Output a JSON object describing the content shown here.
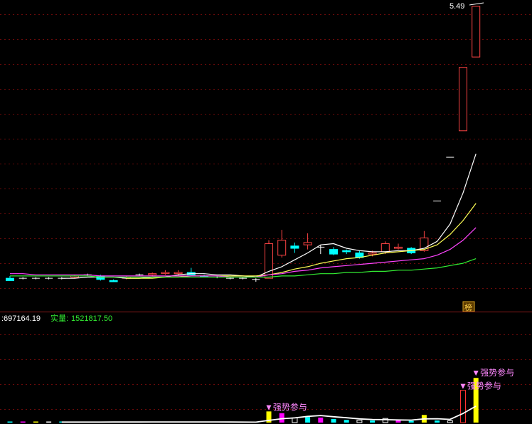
{
  "chart_data": {
    "type": "candlestick",
    "price_panel": {
      "max_label": "5.49",
      "marker_label": "榜",
      "ylim": [
        3.1,
        5.52
      ],
      "grid": true,
      "candles": [
        {
          "o": 3.13,
          "h": 3.15,
          "l": 3.11,
          "c": 3.11
        },
        {
          "o": 3.13,
          "h": 3.14,
          "l": 3.12,
          "c": 3.13
        },
        {
          "o": 3.13,
          "h": 3.14,
          "l": 3.12,
          "c": 3.13
        },
        {
          "o": 3.13,
          "h": 3.14,
          "l": 3.12,
          "c": 3.13
        },
        {
          "o": 3.13,
          "h": 3.14,
          "l": 3.12,
          "c": 3.13
        },
        {
          "o": 3.14,
          "h": 3.16,
          "l": 3.13,
          "c": 3.15
        },
        {
          "o": 3.16,
          "h": 3.17,
          "l": 3.15,
          "c": 3.16
        },
        {
          "o": 3.15,
          "h": 3.16,
          "l": 3.11,
          "c": 3.12
        },
        {
          "o": 3.11,
          "h": 3.12,
          "l": 3.1,
          "c": 3.1
        },
        {
          "o": 3.13,
          "h": 3.15,
          "l": 3.12,
          "c": 3.14
        },
        {
          "o": 3.16,
          "h": 3.17,
          "l": 3.15,
          "c": 3.16
        },
        {
          "o": 3.16,
          "h": 3.18,
          "l": 3.15,
          "c": 3.17
        },
        {
          "o": 3.17,
          "h": 3.2,
          "l": 3.16,
          "c": 3.18
        },
        {
          "o": 3.17,
          "h": 3.2,
          "l": 3.15,
          "c": 3.18
        },
        {
          "o": 3.18,
          "h": 3.22,
          "l": 3.16,
          "c": 3.16
        },
        {
          "o": 3.15,
          "h": 3.16,
          "l": 3.14,
          "c": 3.14
        },
        {
          "o": 3.14,
          "h": 3.15,
          "l": 3.13,
          "c": 3.14
        },
        {
          "o": 3.13,
          "h": 3.14,
          "l": 3.12,
          "c": 3.13
        },
        {
          "o": 3.13,
          "h": 3.14,
          "l": 3.12,
          "c": 3.13
        },
        {
          "o": 3.12,
          "h": 3.13,
          "l": 3.1,
          "c": 3.12
        },
        {
          "o": 3.13,
          "h": 3.46,
          "l": 3.13,
          "c": 3.43
        },
        {
          "o": 3.33,
          "h": 3.55,
          "l": 3.31,
          "c": 3.46
        },
        {
          "o": 3.41,
          "h": 3.44,
          "l": 3.35,
          "c": 3.39
        },
        {
          "o": 3.42,
          "h": 3.52,
          "l": 3.38,
          "c": 3.44
        },
        {
          "o": 3.4,
          "h": 3.42,
          "l": 3.34,
          "c": 3.4
        },
        {
          "o": 3.38,
          "h": 3.4,
          "l": 3.33,
          "c": 3.34
        },
        {
          "o": 3.37,
          "h": 3.38,
          "l": 3.34,
          "c": 3.36
        },
        {
          "o": 3.35,
          "h": 3.37,
          "l": 3.3,
          "c": 3.31
        },
        {
          "o": 3.34,
          "h": 3.37,
          "l": 3.32,
          "c": 3.35
        },
        {
          "o": 3.36,
          "h": 3.45,
          "l": 3.34,
          "c": 3.43
        },
        {
          "o": 3.39,
          "h": 3.43,
          "l": 3.38,
          "c": 3.4
        },
        {
          "o": 3.39,
          "h": 3.4,
          "l": 3.34,
          "c": 3.35
        },
        {
          "o": 3.37,
          "h": 3.54,
          "l": 3.36,
          "c": 3.48
        },
        {
          "o": 3.8,
          "h": 3.8,
          "l": 3.8,
          "c": 3.8
        },
        {
          "o": 4.18,
          "h": 4.18,
          "l": 4.18,
          "c": 4.18
        },
        {
          "o": 4.41,
          "h": 4.96,
          "l": 4.41,
          "c": 4.96
        },
        {
          "o": 5.05,
          "h": 5.49,
          "l": 5.05,
          "c": 5.49
        }
      ],
      "ma_lines": [
        {
          "name": "ma-white",
          "color": "#ffffff",
          "values": [
            null,
            null,
            null,
            null,
            3.13,
            3.13,
            3.14,
            3.14,
            3.14,
            3.13,
            3.13,
            3.14,
            3.14,
            3.16,
            3.17,
            3.17,
            3.16,
            3.16,
            3.15,
            3.14,
            3.19,
            3.23,
            3.29,
            3.35,
            3.42,
            3.43,
            3.39,
            3.37,
            3.36,
            3.36,
            3.37,
            3.37,
            3.39,
            3.45,
            3.6,
            3.87,
            4.21
          ]
        },
        {
          "name": "ma-yellow",
          "color": "#ffff55",
          "values": [
            null,
            null,
            null,
            null,
            null,
            null,
            null,
            null,
            null,
            3.13,
            3.13,
            3.13,
            3.14,
            3.14,
            3.15,
            3.15,
            3.15,
            3.15,
            3.15,
            3.15,
            3.16,
            3.18,
            3.21,
            3.23,
            3.26,
            3.28,
            3.3,
            3.31,
            3.33,
            3.35,
            3.36,
            3.37,
            3.38,
            3.42,
            3.51,
            3.63,
            3.78
          ]
        },
        {
          "name": "ma-magenta",
          "color": "#ff44ff",
          "values": [
            3.17,
            3.17,
            3.16,
            3.16,
            3.16,
            3.16,
            3.16,
            3.15,
            3.15,
            3.15,
            3.15,
            3.15,
            3.15,
            3.15,
            3.15,
            3.15,
            3.15,
            3.14,
            3.14,
            3.14,
            3.16,
            3.17,
            3.19,
            3.2,
            3.22,
            3.23,
            3.24,
            3.25,
            3.26,
            3.27,
            3.28,
            3.29,
            3.3,
            3.33,
            3.38,
            3.46,
            3.57
          ]
        },
        {
          "name": "ma-green",
          "color": "#33ee33",
          "values": [
            3.15,
            3.15,
            3.15,
            3.15,
            3.15,
            3.15,
            3.15,
            3.14,
            3.14,
            3.14,
            3.14,
            3.14,
            3.14,
            3.14,
            3.14,
            3.14,
            3.14,
            3.14,
            3.14,
            3.14,
            3.14,
            3.15,
            3.15,
            3.16,
            3.17,
            3.17,
            3.18,
            3.18,
            3.19,
            3.19,
            3.2,
            3.2,
            3.21,
            3.22,
            3.24,
            3.26,
            3.3
          ]
        }
      ]
    },
    "volume_panel": {
      "header_value": ":697164.19",
      "real_label": "实量:",
      "real_value": "1521817.50",
      "annotation": "▼强势参与",
      "annotation_indices": [
        20,
        35,
        36
      ],
      "ylim": [
        0,
        1600000
      ],
      "volumes": [
        15000,
        12000,
        16000,
        14000,
        13000,
        18000,
        16000,
        22000,
        15000,
        25000,
        20000,
        18000,
        28000,
        24000,
        26000,
        15000,
        17000,
        14000,
        12000,
        18000,
        380000,
        320000,
        160000,
        190000,
        170000,
        120000,
        90000,
        80000,
        70000,
        140000,
        90000,
        60000,
        260000,
        70000,
        60000,
        1100000,
        1521817.5
      ],
      "volume_colors": [
        "#00ffff",
        "#ff00ff",
        "#ffff00",
        "#ffffff",
        "#00ffff",
        "#ff00ff",
        "#ffff00",
        "#00ffff",
        "#ffffff",
        "#ff00ff",
        "#ffff00",
        "#00ffff",
        "#ff00ff",
        "#ffffff",
        "#ffff00",
        "#00ffff",
        "#ff00ff",
        "#ffffff",
        "#ffff00",
        "#00ffff",
        "#ffff00",
        "#ff00ff",
        "#ffffff",
        "#00ffff",
        "#ff00ff",
        "#00ffff",
        "#00ffff",
        "#ffffff",
        "#00ffff",
        "#ffffff",
        "#ff00ff",
        "#00ffff",
        "#ffff00",
        "#00ffff",
        "#ffffff",
        "#ff3333",
        "#ffff00"
      ],
      "volume_ma": [
        null,
        null,
        null,
        null,
        16000,
        16000,
        17000,
        18000,
        19000,
        19000,
        20000,
        21000,
        22000,
        23000,
        23000,
        22000,
        21000,
        20000,
        18000,
        15000,
        75000,
        130000,
        160000,
        210000,
        240000,
        200000,
        165000,
        125000,
        105000,
        100000,
        90000,
        85000,
        125000,
        130000,
        110000,
        310000,
        560000
      ]
    }
  }
}
